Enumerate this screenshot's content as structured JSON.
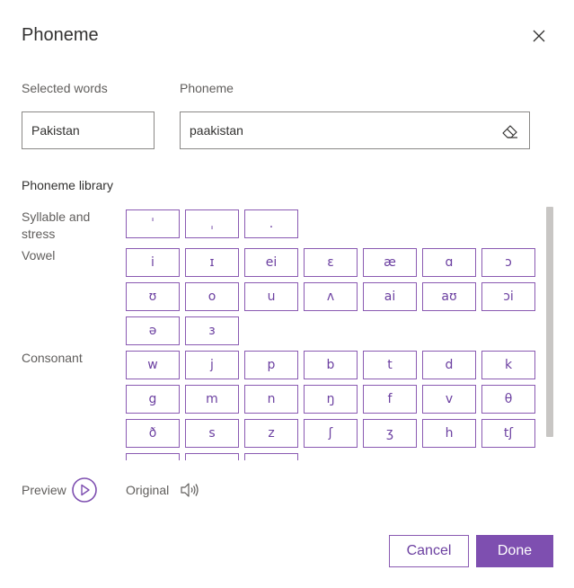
{
  "dialog": {
    "title": "Phoneme"
  },
  "form": {
    "selected_words_label": "Selected words",
    "selected_words_value": "Pakistan",
    "phoneme_label": "Phoneme",
    "phoneme_value": "paakistan"
  },
  "library": {
    "title": "Phoneme library",
    "syllable_label": "Syllable and stress",
    "syllable_keys": [
      "ˈ",
      "ˌ",
      "."
    ],
    "vowel_label": "Vowel",
    "vowel_keys": [
      "i",
      "ɪ",
      "ei",
      "ɛ",
      "æ",
      "ɑ",
      "ɔ",
      "ʊ",
      "o",
      "u",
      "ʌ",
      "ai",
      "aʊ",
      "ɔi",
      "ə",
      "ɜ"
    ],
    "consonant_label": "Consonant",
    "consonant_keys": [
      "w",
      "j",
      "p",
      "b",
      "t",
      "d",
      "k",
      "g",
      "m",
      "n",
      "ŋ",
      "f",
      "v",
      "θ",
      "ð",
      "s",
      "z",
      "ʃ",
      "ʒ",
      "h",
      "tʃ",
      "",
      "",
      ""
    ]
  },
  "footer": {
    "preview_label": "Preview",
    "original_label": "Original",
    "cancel_label": "Cancel",
    "done_label": "Done"
  },
  "colors": {
    "accent": "#7e4fb0",
    "key_border": "#8a5ab2",
    "key_text": "#6b3fa0"
  },
  "icons": {
    "close": "close-icon",
    "eraser": "eraser-icon",
    "play": "play-circle-icon",
    "speaker": "speaker-icon"
  }
}
